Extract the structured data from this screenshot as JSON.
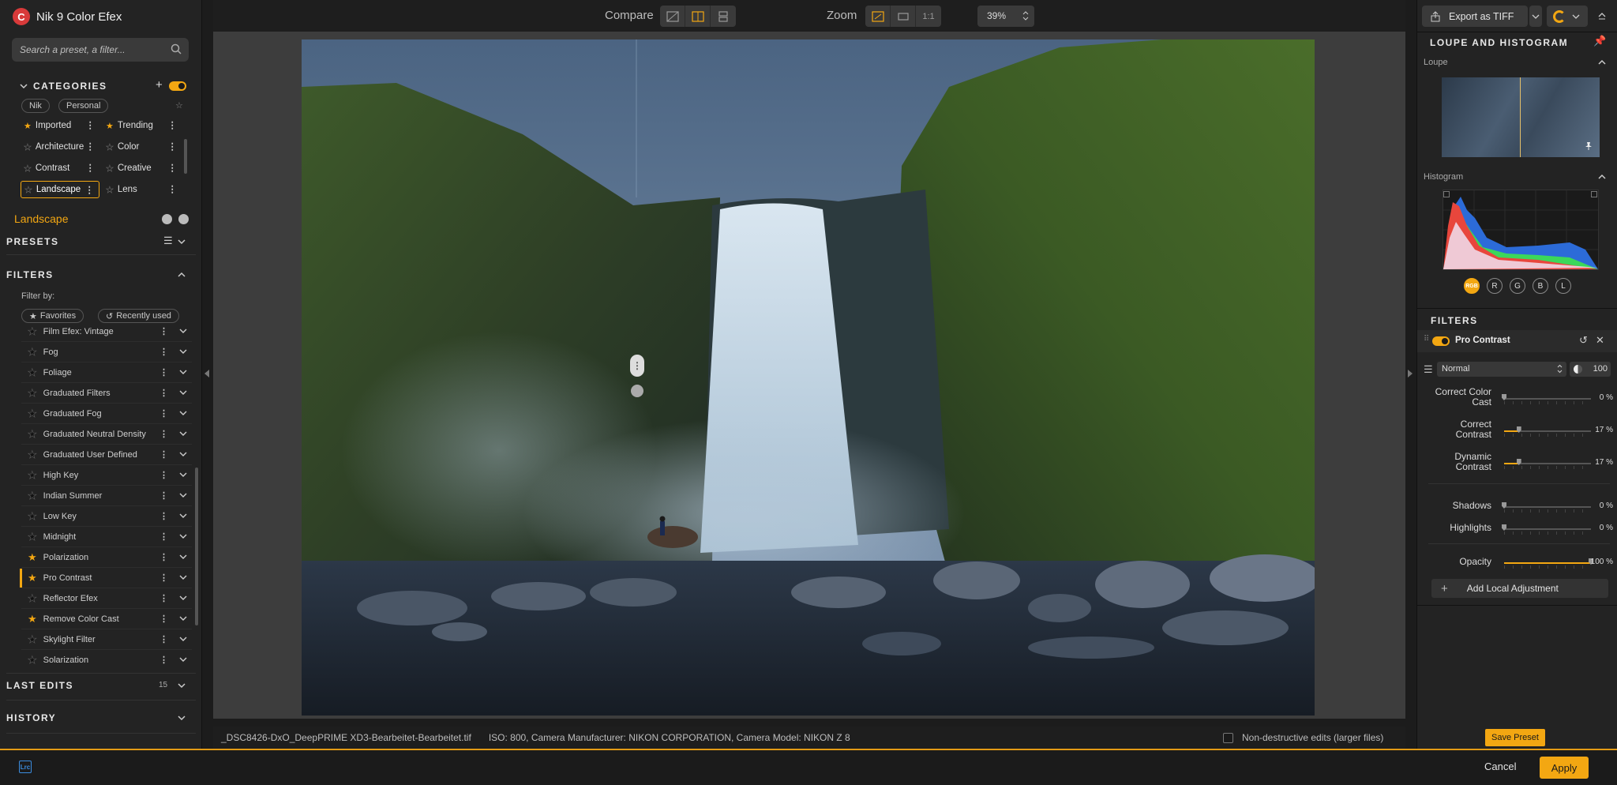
{
  "app": {
    "title": "Nik 9 Color Efex"
  },
  "search": {
    "placeholder": "Search a preset, a filter..."
  },
  "categories": {
    "heading": "CATEGORIES",
    "tags": [
      "Nik",
      "Personal"
    ],
    "items": [
      {
        "label": "Imported",
        "starred": true
      },
      {
        "label": "Trending",
        "starred": true
      },
      {
        "label": "Architecture",
        "starred": false
      },
      {
        "label": "Color",
        "starred": false
      },
      {
        "label": "Contrast",
        "starred": false
      },
      {
        "label": "Creative",
        "starred": false
      },
      {
        "label": "Landscape",
        "starred": false,
        "selected": true
      },
      {
        "label": "Lens",
        "starred": false
      }
    ],
    "current": "Landscape"
  },
  "presets": {
    "heading": "PRESETS"
  },
  "filters_panel": {
    "heading": "FILTERS",
    "filter_by": "Filter by:",
    "chips": [
      "Favorites",
      "Recently used"
    ],
    "items": [
      {
        "label": "Film Efex: Vintage",
        "starred": false
      },
      {
        "label": "Fog",
        "starred": false
      },
      {
        "label": "Foliage",
        "starred": false
      },
      {
        "label": "Graduated Filters",
        "starred": false
      },
      {
        "label": "Graduated Fog",
        "starred": false
      },
      {
        "label": "Graduated Neutral Density",
        "starred": false
      },
      {
        "label": "Graduated User Defined",
        "starred": false
      },
      {
        "label": "High Key",
        "starred": false
      },
      {
        "label": "Indian Summer",
        "starred": false
      },
      {
        "label": "Low Key",
        "starred": false
      },
      {
        "label": "Midnight",
        "starred": false
      },
      {
        "label": "Polarization",
        "starred": true
      },
      {
        "label": "Pro Contrast",
        "starred": true,
        "active": true
      },
      {
        "label": "Reflector Efex",
        "starred": false
      },
      {
        "label": "Remove Color Cast",
        "starred": true
      },
      {
        "label": "Skylight Filter",
        "starred": false
      },
      {
        "label": "Solarization",
        "starred": false
      }
    ]
  },
  "last_edits": {
    "heading": "LAST EDITS",
    "count": "15"
  },
  "history": {
    "heading": "HISTORY"
  },
  "toolbar": {
    "compare": "Compare",
    "zoom": "Zoom",
    "zoom_one": "1:1",
    "zoom_value": "39%"
  },
  "status": {
    "filename": "_DSC8426-DxO_DeepPRIME XD3-Bearbeitet-Bearbeitet.tif",
    "meta": "ISO: 800, Camera Manufacturer: NIKON CORPORATION, Camera Model: NIKON Z 8",
    "nondestructive": "Non-destructive edits (larger files)"
  },
  "right": {
    "export": "Export as TIFF",
    "loupe_heading": "LOUPE AND HISTOGRAM",
    "loupe": "Loupe",
    "histogram": "Histogram",
    "channels": [
      "RGB",
      "R",
      "G",
      "B",
      "L"
    ],
    "filters_heading": "FILTERS",
    "filter_name": "Pro Contrast",
    "blend_mode": "Normal",
    "opacity_value": "100",
    "sliders": [
      {
        "label": "Correct Color Cast",
        "value": "0 %",
        "level": 0
      },
      {
        "label": "Correct Contrast",
        "value": "17 %",
        "level": 17
      },
      {
        "label": "Dynamic Contrast",
        "value": "17 %",
        "level": 17
      },
      {
        "label": "Shadows",
        "value": "0 %",
        "level": 0
      },
      {
        "label": "Highlights",
        "value": "0 %",
        "level": 0
      },
      {
        "label": "Opacity",
        "value": "100 %",
        "level": 100
      }
    ],
    "add_local": "Add Local Adjustment",
    "save_preset": "Save Preset"
  },
  "bottom": {
    "lrc": "Lrc",
    "cancel": "Cancel",
    "apply": "Apply"
  },
  "colors": {
    "accent": "#f3a712",
    "panel": "#232323"
  }
}
